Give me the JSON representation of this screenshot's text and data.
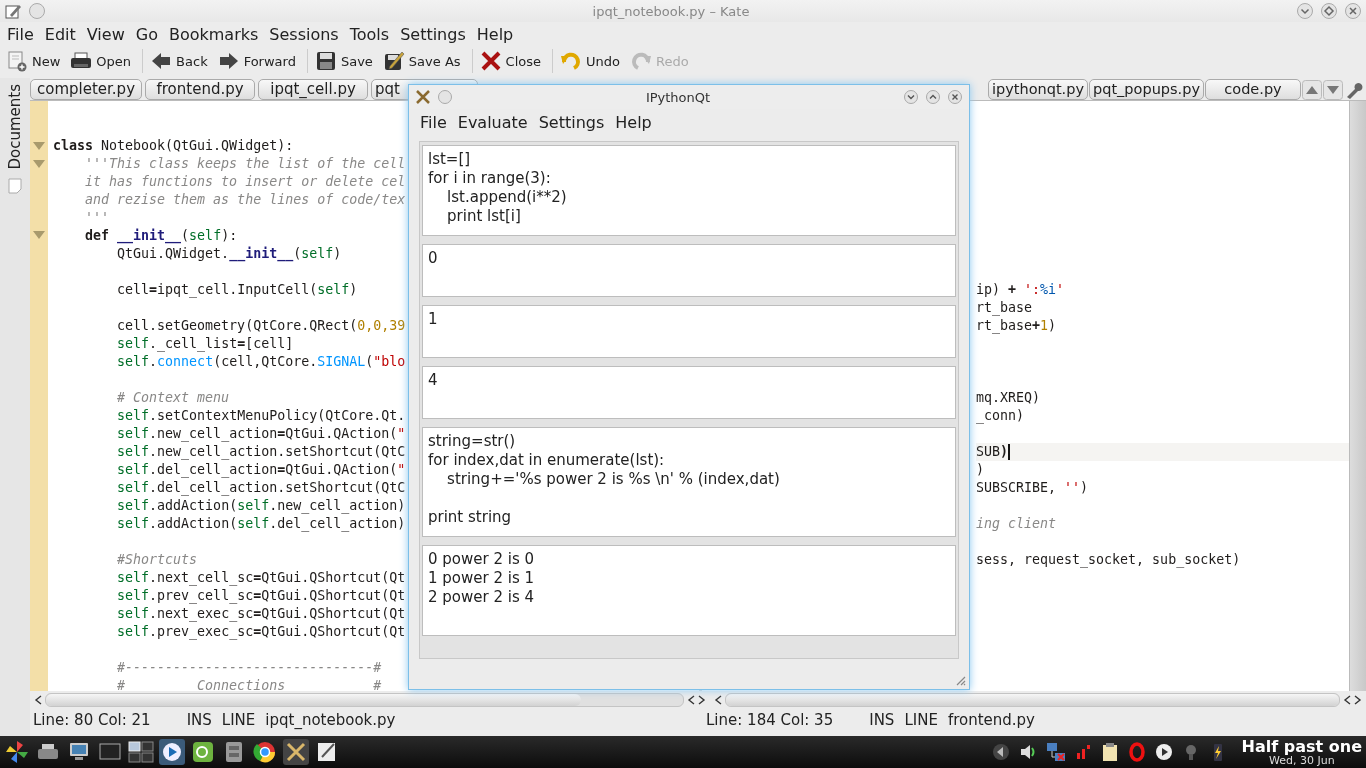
{
  "window": {
    "title": "ipqt_notebook.py – Kate"
  },
  "menu": [
    "File",
    "Edit",
    "View",
    "Go",
    "Bookmarks",
    "Sessions",
    "Tools",
    "Settings",
    "Help"
  ],
  "toolbar": [
    {
      "kind": "new",
      "label": "New",
      "disabled": false
    },
    {
      "kind": "open",
      "label": "Open",
      "disabled": false
    },
    {
      "kind": "back",
      "label": "Back",
      "disabled": false
    },
    {
      "kind": "forward",
      "label": "Forward",
      "disabled": false
    },
    {
      "kind": "save",
      "label": "Save",
      "disabled": false
    },
    {
      "kind": "saveas",
      "label": "Save As",
      "disabled": false
    },
    {
      "kind": "close",
      "label": "Close",
      "disabled": false
    },
    {
      "kind": "undo",
      "label": "Undo",
      "disabled": false
    },
    {
      "kind": "redo",
      "label": "Redo",
      "disabled": true
    }
  ],
  "sidebar": {
    "label": "Documents"
  },
  "tab_bar": {
    "left": [
      {
        "label": "completer.py",
        "selected": false
      },
      {
        "label": "frontend.py",
        "selected": false
      },
      {
        "label": "ipqt_cell.py",
        "selected": false
      },
      {
        "label": "pqt",
        "selected": false
      }
    ],
    "right": [
      {
        "label": "ipythonqt.py",
        "selected": false
      },
      {
        "label": "pqt_popups.py",
        "selected": false
      },
      {
        "label": "code.py",
        "selected": false
      }
    ]
  },
  "views": [
    {
      "lines": [
        {
          "kind": "blank"
        },
        {
          "kind": "blank"
        },
        {
          "kind": "code",
          "fold": true,
          "tokens": [
            {
              "kind": "keyword",
              "text": "class"
            },
            {
              "kind": "plain",
              "text": " Notebook(QtGui.QWidget):"
            }
          ]
        },
        {
          "kind": "code",
          "fold": true,
          "tokens": [
            {
              "kind": "comment",
              "text": "    '''This class keeps the list of the cell"
            }
          ]
        },
        {
          "kind": "code",
          "fold": false,
          "tokens": [
            {
              "kind": "comment",
              "text": "    it has functions to insert or delete cel"
            }
          ]
        },
        {
          "kind": "code",
          "fold": false,
          "tokens": [
            {
              "kind": "comment",
              "text": "    and rezise them as the lines of code/tex"
            }
          ]
        },
        {
          "kind": "code",
          "fold": false,
          "tokens": [
            {
              "kind": "comment",
              "text": "    '''"
            }
          ]
        },
        {
          "kind": "code",
          "fold": true,
          "tokens": [
            {
              "kind": "keyword",
              "text": "    def "
            },
            {
              "kind": "dunder",
              "text": "__init__"
            },
            {
              "kind": "plain",
              "text": "("
            },
            {
              "kind": "self",
              "text": "self"
            },
            {
              "kind": "plain",
              "text": "):"
            }
          ]
        },
        {
          "kind": "code",
          "fold": false,
          "tokens": [
            {
              "kind": "plain",
              "text": "        QtGui.QWidget."
            },
            {
              "kind": "dunder",
              "text": "__init__"
            },
            {
              "kind": "plain",
              "text": "("
            },
            {
              "kind": "self",
              "text": "self"
            },
            {
              "kind": "plain",
              "text": ")"
            }
          ]
        },
        {
          "kind": "blank"
        },
        {
          "kind": "code",
          "fold": false,
          "tokens": [
            {
              "kind": "plain",
              "text": "        cell"
            },
            {
              "kind": "op",
              "text": "="
            },
            {
              "kind": "plain",
              "text": "ipqt_cell.InputCell("
            },
            {
              "kind": "self",
              "text": "self"
            },
            {
              "kind": "plain",
              "text": ")"
            }
          ]
        },
        {
          "kind": "blank"
        },
        {
          "kind": "code",
          "fold": false,
          "tokens": [
            {
              "kind": "plain",
              "text": "        cell.setGeometry(QtCore.QRect("
            },
            {
              "kind": "number",
              "text": "0,0,39"
            }
          ]
        },
        {
          "kind": "code",
          "fold": false,
          "tokens": [
            {
              "kind": "self",
              "text": "        self"
            },
            {
              "kind": "plain",
              "text": "._cell_list"
            },
            {
              "kind": "op",
              "text": "="
            },
            {
              "kind": "plain",
              "text": "[cell]"
            }
          ]
        },
        {
          "kind": "code",
          "fold": false,
          "tokens": [
            {
              "kind": "self",
              "text": "        self"
            },
            {
              "kind": "plain",
              "text": "."
            },
            {
              "kind": "builtin",
              "text": "connect"
            },
            {
              "kind": "plain",
              "text": "(cell,QtCore."
            },
            {
              "kind": "builtin",
              "text": "SIGNAL"
            },
            {
              "kind": "plain",
              "text": "("
            },
            {
              "kind": "string",
              "text": "\"blo"
            }
          ]
        },
        {
          "kind": "blank"
        },
        {
          "kind": "code",
          "fold": false,
          "tokens": [
            {
              "kind": "comment",
              "text": "        # Context menu"
            }
          ]
        },
        {
          "kind": "code",
          "fold": false,
          "tokens": [
            {
              "kind": "self",
              "text": "        self"
            },
            {
              "kind": "plain",
              "text": ".setContextMenuPolicy(QtCore.Qt."
            }
          ]
        },
        {
          "kind": "code",
          "fold": false,
          "tokens": [
            {
              "kind": "self",
              "text": "        self"
            },
            {
              "kind": "plain",
              "text": ".new_cell_action"
            },
            {
              "kind": "op",
              "text": "="
            },
            {
              "kind": "plain",
              "text": "QtGui.QAction("
            },
            {
              "kind": "string",
              "text": "\""
            }
          ]
        },
        {
          "kind": "code",
          "fold": false,
          "tokens": [
            {
              "kind": "self",
              "text": "        self"
            },
            {
              "kind": "plain",
              "text": ".new_cell_action.setShortcut(QtC"
            }
          ]
        },
        {
          "kind": "code",
          "fold": false,
          "tokens": [
            {
              "kind": "self",
              "text": "        self"
            },
            {
              "kind": "plain",
              "text": ".del_cell_action"
            },
            {
              "kind": "op",
              "text": "="
            },
            {
              "kind": "plain",
              "text": "QtGui.QAction("
            },
            {
              "kind": "string",
              "text": "\""
            }
          ]
        },
        {
          "kind": "code",
          "fold": false,
          "tokens": [
            {
              "kind": "self",
              "text": "        self"
            },
            {
              "kind": "plain",
              "text": ".del_cell_action.setShortcut(QtC"
            }
          ]
        },
        {
          "kind": "code",
          "fold": false,
          "tokens": [
            {
              "kind": "self",
              "text": "        self"
            },
            {
              "kind": "plain",
              "text": ".addAction("
            },
            {
              "kind": "self",
              "text": "self"
            },
            {
              "kind": "plain",
              "text": ".new_cell_action)"
            }
          ]
        },
        {
          "kind": "code",
          "fold": false,
          "tokens": [
            {
              "kind": "self",
              "text": "        self"
            },
            {
              "kind": "plain",
              "text": ".addAction("
            },
            {
              "kind": "self",
              "text": "self"
            },
            {
              "kind": "plain",
              "text": ".del_cell_action)"
            }
          ]
        },
        {
          "kind": "blank"
        },
        {
          "kind": "code",
          "fold": false,
          "tokens": [
            {
              "kind": "comment",
              "text": "        #Shortcuts"
            }
          ]
        },
        {
          "kind": "code",
          "fold": false,
          "tokens": [
            {
              "kind": "self",
              "text": "        self"
            },
            {
              "kind": "plain",
              "text": ".next_cell_sc"
            },
            {
              "kind": "op",
              "text": "="
            },
            {
              "kind": "plain",
              "text": "QtGui.QShortcut(Qt"
            }
          ]
        },
        {
          "kind": "code",
          "fold": false,
          "tokens": [
            {
              "kind": "self",
              "text": "        self"
            },
            {
              "kind": "plain",
              "text": ".prev_cell_sc"
            },
            {
              "kind": "op",
              "text": "="
            },
            {
              "kind": "plain",
              "text": "QtGui.QShortcut(Qt"
            }
          ]
        },
        {
          "kind": "code",
          "fold": false,
          "tokens": [
            {
              "kind": "self",
              "text": "        self"
            },
            {
              "kind": "plain",
              "text": ".next_exec_sc"
            },
            {
              "kind": "op",
              "text": "="
            },
            {
              "kind": "plain",
              "text": "QtGui.QShortcut(Qt"
            }
          ]
        },
        {
          "kind": "code",
          "fold": false,
          "tokens": [
            {
              "kind": "self",
              "text": "        self"
            },
            {
              "kind": "plain",
              "text": ".prev_exec_sc"
            },
            {
              "kind": "op",
              "text": "="
            },
            {
              "kind": "plain",
              "text": "QtGui.QShortcut(Qt"
            }
          ]
        },
        {
          "kind": "blank"
        },
        {
          "kind": "code",
          "fold": false,
          "tokens": [
            {
              "kind": "comment",
              "text": "        #-------------------------------#"
            }
          ]
        },
        {
          "kind": "code",
          "fold": false,
          "tokens": [
            {
              "kind": "comment",
              "text": "        #         Connections           #"
            }
          ]
        }
      ]
    },
    {
      "lines": [
        {
          "kind": "blank"
        },
        {
          "kind": "blank"
        },
        {
          "kind": "blank"
        },
        {
          "kind": "blank"
        },
        {
          "kind": "blank"
        },
        {
          "kind": "blank"
        },
        {
          "kind": "blank"
        },
        {
          "kind": "blank"
        },
        {
          "kind": "blank"
        },
        {
          "kind": "blank"
        },
        {
          "kind": "code",
          "current": false,
          "tokens": [
            {
              "kind": "plain",
              "text": "ip) "
            },
            {
              "kind": "op",
              "text": "+"
            },
            {
              "kind": "string",
              "text": " ':"
            },
            {
              "kind": "format",
              "text": "%i"
            },
            {
              "kind": "string",
              "text": "'"
            }
          ]
        },
        {
          "kind": "code",
          "current": false,
          "tokens": [
            {
              "kind": "plain",
              "text": "rt_base"
            }
          ]
        },
        {
          "kind": "code",
          "current": false,
          "tokens": [
            {
              "kind": "plain",
              "text": "rt_base"
            },
            {
              "kind": "op",
              "text": "+"
            },
            {
              "kind": "number",
              "text": "1"
            },
            {
              "kind": "plain",
              "text": ")"
            }
          ]
        },
        {
          "kind": "blank"
        },
        {
          "kind": "blank"
        },
        {
          "kind": "blank"
        },
        {
          "kind": "code",
          "current": false,
          "tokens": [
            {
              "kind": "plain",
              "text": "mq.XREQ)"
            }
          ]
        },
        {
          "kind": "code",
          "current": false,
          "tokens": [
            {
              "kind": "plain",
              "text": "_conn)"
            }
          ]
        },
        {
          "kind": "blank"
        },
        {
          "kind": "code",
          "current": true,
          "tokens": [
            {
              "kind": "plain",
              "text": "SUB"
            },
            {
              "kind": "op",
              "text": ")"
            }
          ]
        },
        {
          "kind": "code",
          "current": false,
          "tokens": [
            {
              "kind": "plain",
              "text": ")"
            }
          ]
        },
        {
          "kind": "code",
          "current": false,
          "tokens": [
            {
              "kind": "plain",
              "text": "SUBSCRIBE, "
            },
            {
              "kind": "string",
              "text": "''"
            },
            {
              "kind": "plain",
              "text": ")"
            }
          ]
        },
        {
          "kind": "blank"
        },
        {
          "kind": "code",
          "current": false,
          "tokens": [
            {
              "kind": "comment",
              "text": "ing client"
            }
          ]
        },
        {
          "kind": "blank"
        },
        {
          "kind": "code",
          "current": false,
          "tokens": [
            {
              "kind": "plain",
              "text": "sess, request_socket, sub_socket)"
            }
          ]
        }
      ]
    }
  ],
  "status": [
    {
      "position": "Line: 80 Col: 21",
      "mode": "INS",
      "selection": "LINE",
      "file": "ipqt_notebook.py"
    },
    {
      "position": "Line: 184 Col: 35",
      "mode": "INS",
      "selection": "LINE",
      "file": "frontend.py"
    }
  ],
  "dialog": {
    "title": "IPythonQt",
    "menu": [
      "File",
      "Evaluate",
      "Settings",
      "Help"
    ],
    "cells": [
      {
        "kind": "input",
        "text": "lst=[]\nfor i in range(3):\n    lst.append(i**2)\n    print lst[i]"
      },
      {
        "kind": "output",
        "text": "0"
      },
      {
        "kind": "output",
        "text": "1"
      },
      {
        "kind": "output",
        "text": "4"
      },
      {
        "kind": "input",
        "text": "string=str()\nfor index,dat in enumerate(lst):\n    string+='%s power 2 is %s \\n' % (index,dat)\n\nprint string"
      },
      {
        "kind": "output",
        "text": "0 power 2 is 0\n1 power 2 is 1\n2 power 2 is 4"
      }
    ]
  },
  "taskbar": {
    "clock": {
      "time": "Half past one",
      "date": "Wed, 30 Jun"
    }
  }
}
